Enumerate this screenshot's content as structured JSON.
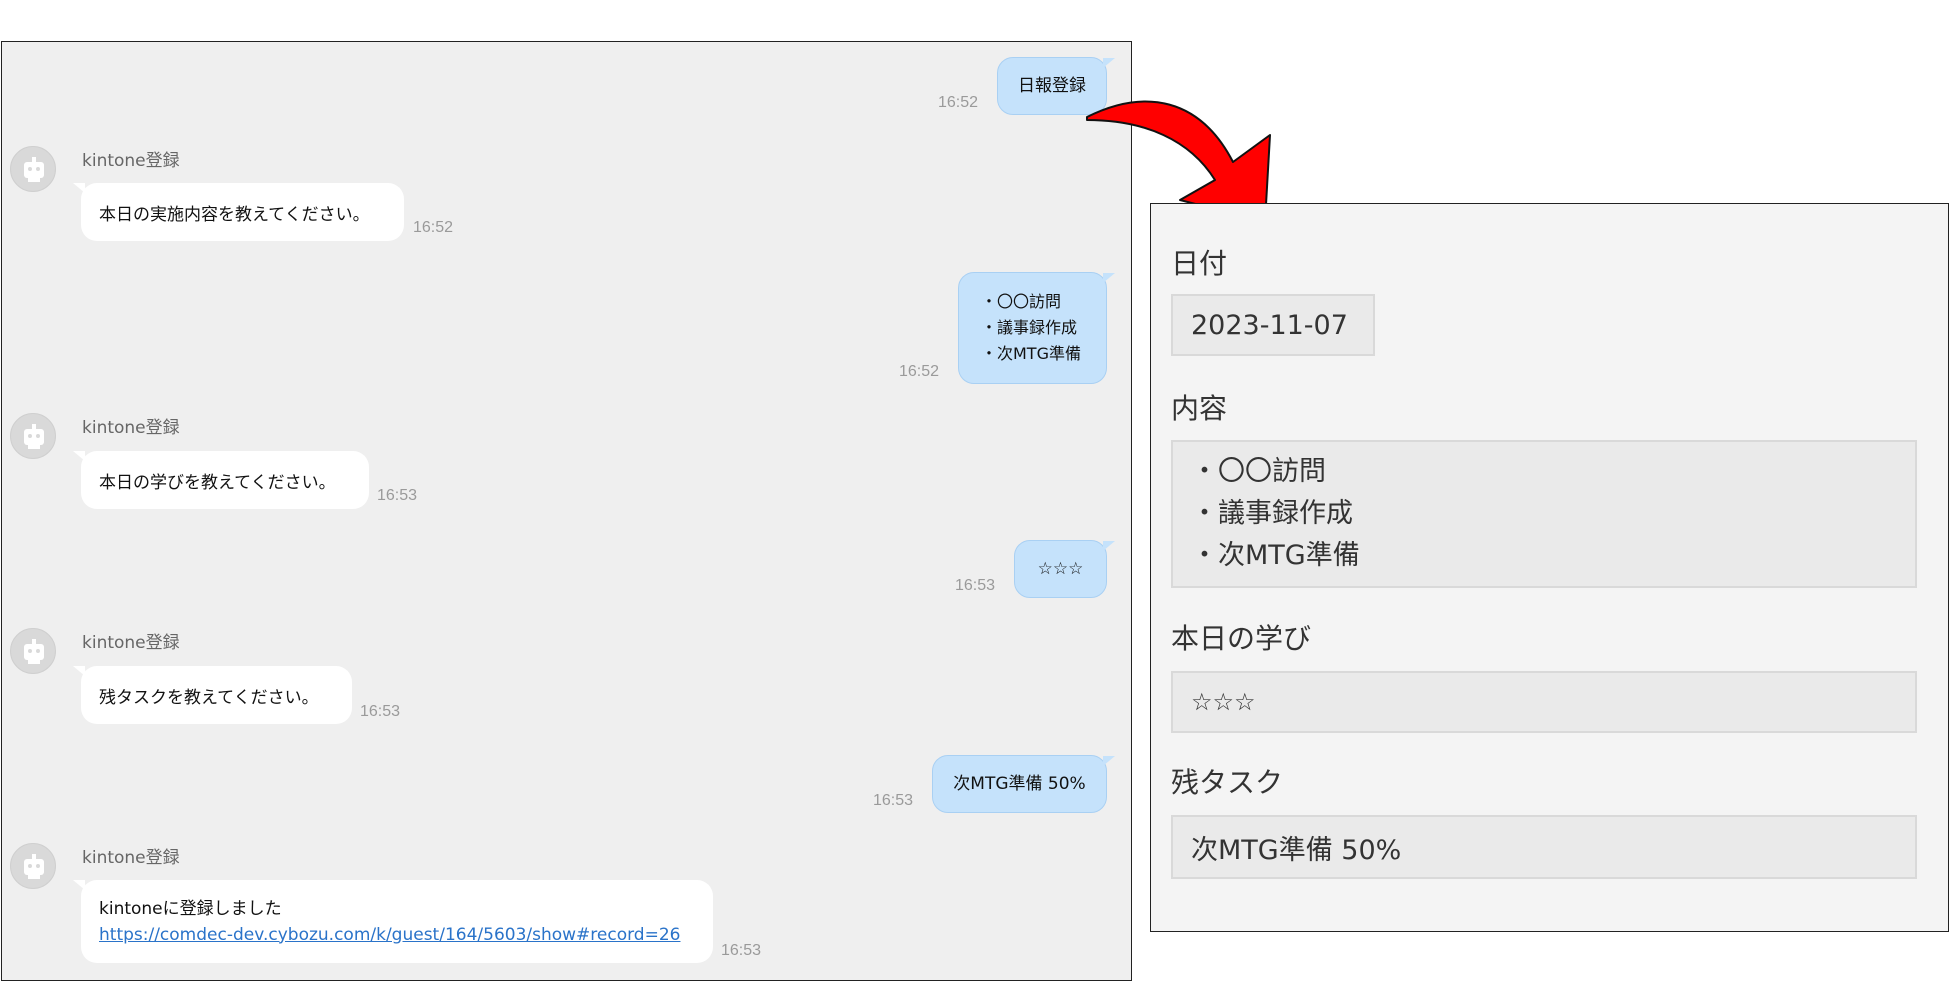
{
  "chat": {
    "messages": [
      {
        "from": "user",
        "text": "日報登録",
        "time": "16:52"
      },
      {
        "from": "bot",
        "name": "kintone登録",
        "text": "本日の実施内容を教えてください。",
        "time": "16:52"
      },
      {
        "from": "user",
        "lines": [
          "・〇〇訪問",
          "・議事録作成",
          "・次MTG準備"
        ],
        "time": "16:52"
      },
      {
        "from": "bot",
        "name": "kintone登録",
        "text": "本日の学びを教えてください。",
        "time": "16:53"
      },
      {
        "from": "user",
        "text": "☆☆☆",
        "time": "16:53"
      },
      {
        "from": "bot",
        "name": "kintone登録",
        "text": "残タスクを教えてください。",
        "time": "16:53"
      },
      {
        "from": "user",
        "text": "次MTG準備 50%",
        "time": "16:53"
      },
      {
        "from": "bot",
        "name": "kintone登録",
        "text": "kintoneに登録しました",
        "link": "https://comdec-dev.cybozu.com/k/guest/164/5603/show#record=26",
        "time": "16:53"
      }
    ]
  },
  "arrow_icon": "curved-arrow-icon",
  "arrow_color": "#ff0000",
  "record": {
    "fields": [
      {
        "label": "日付",
        "value": "2023-11-07"
      },
      {
        "label": "内容",
        "lines": [
          "・〇〇訪問",
          "・議事録作成",
          "・次MTG準備"
        ]
      },
      {
        "label": "本日の学び",
        "value": "☆☆☆"
      },
      {
        "label": "残タスク",
        "value": "次MTG準備 50%"
      }
    ]
  },
  "colors": {
    "user_bubble": "#c5e2fb",
    "bot_bubble": "#ffffff",
    "chat_background": "#efefef",
    "link": "#2a73c9"
  }
}
